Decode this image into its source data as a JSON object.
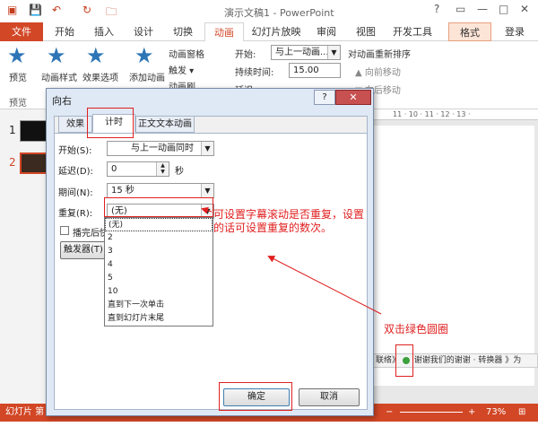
{
  "window": {
    "title": "演示文稿1 - PowerPoint",
    "help": "?",
    "close": "✕"
  },
  "tabs": [
    "文件",
    "开始",
    "插入",
    "设计",
    "切换",
    "动画",
    "幻灯片放映",
    "审阅",
    "视图",
    "开发工具",
    "格式",
    "登录"
  ],
  "ribbon": {
    "preview": "预览",
    "preview_group": "预览",
    "anim_style": "动画样式",
    "effect_options": "效果选项",
    "add_anim": "添加动画",
    "anim_pane": "动画窗格",
    "trigger": "触发 ▾",
    "anim_painter": "动画刷",
    "start_label": "开始:",
    "start_value": "与上一动画...",
    "duration_label": "持续时间:",
    "duration_value": "15.00",
    "delay_label": "延迟:",
    "reorder": "对动画重新排序",
    "move_earlier": "▲ 向前移动",
    "move_later": "▼ 向后移动"
  },
  "slides": [
    {
      "num": "1"
    },
    {
      "num": "2"
    }
  ],
  "ruler_text": "11 · 10 · 11 · 12 · 13 ·",
  "anim_bar": {
    "prefix": "联络》",
    "item": "谢谢我们的谢谢 · 转换器",
    "suffix": "》为"
  },
  "status": {
    "slide_info": "幻灯片 第 2 张，共 2 张",
    "notes": "备注",
    "comments": "批注",
    "zoom": "73%"
  },
  "dialog": {
    "title": "向右",
    "help": "?",
    "close": "✕",
    "tabs": [
      "效果",
      "计时",
      "正文文本动画"
    ],
    "start_label": "开始(S):",
    "start_value": "与上一动画同时",
    "delay_label": "延迟(D):",
    "delay_value": "0",
    "delay_unit": "秒",
    "period_label": "期间(N):",
    "period_value": "15 秒",
    "repeat_label": "重复(R):",
    "repeat_value": "(无)",
    "rewind_label": "播完后快",
    "trigger_btn": "触发器(T)",
    "repeat_options": [
      "(无)",
      "2",
      "3",
      "4",
      "5",
      "10",
      "直到下一次单击",
      "直到幻灯片末尾"
    ],
    "ok": "确定",
    "cancel": "取消"
  },
  "annotations": {
    "note1": "可设置字幕滚动是否重复，设置的话可设置重复的数次。",
    "note2": "双击绿色圆圈"
  },
  "colors": {
    "accent": "#d24726",
    "annotation": "#e02020",
    "green_dot": "#3ca03c"
  }
}
